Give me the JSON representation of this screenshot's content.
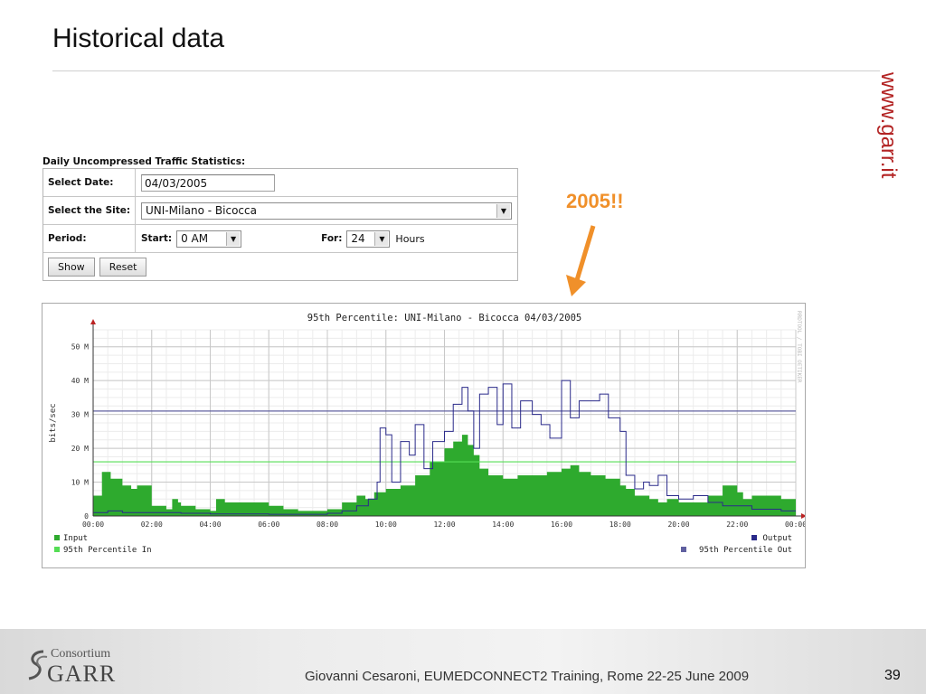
{
  "slide": {
    "title": "Historical data",
    "website": "www.garr.it",
    "annotation": "2005!!",
    "footer_logo_small": "Consortium",
    "footer_logo_big": "GARR",
    "footer_text": "Giovanni Cesaroni, EUMEDCONNECT2 Training, Rome 22-25 June 2009",
    "page_number": "39"
  },
  "form": {
    "title": "Daily Uncompressed Traffic Statistics:",
    "date_label": "Select Date:",
    "date_value": "04/03/2005",
    "site_label": "Select the Site:",
    "site_value": "UNI-Milano - Bicocca",
    "period_label": "Period:",
    "start_label": "Start:",
    "start_value": "0 AM",
    "for_label": "For:",
    "for_value": "24",
    "hours_label": "Hours",
    "show_label": "Show",
    "reset_label": "Reset"
  },
  "colors": {
    "input": "#2eaa2e",
    "output": "#2a2a8a",
    "p95_in": "#55dd55",
    "p95_out": "#6060a0",
    "annotation": "#f0902a",
    "website": "#b32424"
  },
  "chart_data": {
    "type": "area",
    "title": "95th Percentile: UNI-Milano - Bicocca 04/03/2005",
    "ylabel": "bits/sec",
    "xlabel": "",
    "side_text": "RRDTOOL / TOBI OETIKER",
    "ylim": [
      0,
      55
    ],
    "xlim": [
      0,
      24
    ],
    "y_ticks": [
      0,
      10,
      20,
      30,
      40,
      50
    ],
    "y_tick_labels": [
      "0",
      "10 M",
      "20 M",
      "30 M",
      "40 M",
      "50 M"
    ],
    "x_ticks": [
      0,
      2,
      4,
      6,
      8,
      10,
      12,
      14,
      16,
      18,
      20,
      22,
      24
    ],
    "x_tick_labels": [
      "00:00",
      "02:00",
      "04:00",
      "06:00",
      "08:00",
      "10:00",
      "12:00",
      "14:00",
      "16:00",
      "18:00",
      "20:00",
      "22:00",
      "00:00"
    ],
    "grid": true,
    "legend_position": "bottom",
    "legend": [
      "Input",
      "95th Percentile In",
      "Output",
      "95th Percentile Out"
    ],
    "percentile_95_in": 16,
    "percentile_95_out": 31,
    "series": [
      {
        "name": "Input",
        "x": [
          0,
          0.3,
          0.6,
          1.0,
          1.3,
          1.5,
          2.0,
          2.5,
          2.7,
          2.9,
          3.0,
          3.5,
          4.0,
          4.2,
          4.5,
          5.0,
          5.5,
          6.0,
          6.5,
          7.0,
          7.5,
          8.0,
          8.5,
          9.0,
          9.3,
          9.6,
          10.0,
          10.5,
          11.0,
          11.5,
          12.0,
          12.3,
          12.6,
          12.8,
          13.0,
          13.2,
          13.5,
          14.0,
          14.5,
          15.0,
          15.5,
          16.0,
          16.3,
          16.6,
          17.0,
          17.5,
          18.0,
          18.2,
          18.5,
          19.0,
          19.3,
          19.6,
          20.0,
          20.5,
          21.0,
          21.5,
          22.0,
          22.2,
          22.5,
          23.0,
          23.5,
          24.0
        ],
        "values": [
          6,
          13,
          11,
          9,
          8,
          9,
          3,
          2,
          5,
          4,
          3,
          2,
          1.5,
          5,
          4,
          4,
          4,
          3,
          2,
          1.5,
          1.5,
          2,
          4,
          6,
          5,
          7,
          8,
          9,
          12,
          16,
          20,
          22,
          24,
          21,
          18,
          14,
          12,
          11,
          12,
          12,
          13,
          14,
          15,
          13,
          12,
          11,
          9,
          8,
          6,
          5,
          4,
          5,
          4,
          4,
          6,
          9,
          7,
          5,
          6,
          6,
          5,
          5
        ]
      },
      {
        "name": "Output",
        "x": [
          0,
          0.5,
          1.0,
          2.0,
          3.0,
          4.0,
          5.0,
          6.0,
          7.0,
          8.0,
          8.5,
          9.0,
          9.4,
          9.7,
          9.8,
          10.0,
          10.2,
          10.5,
          10.8,
          11.0,
          11.3,
          11.6,
          12.0,
          12.3,
          12.6,
          12.8,
          13.0,
          13.2,
          13.5,
          13.8,
          14.0,
          14.3,
          14.6,
          15.0,
          15.3,
          15.6,
          16.0,
          16.3,
          16.6,
          17.0,
          17.3,
          17.6,
          18.0,
          18.2,
          18.5,
          18.8,
          19.0,
          19.3,
          19.6,
          20.0,
          20.5,
          21.0,
          21.5,
          22.0,
          22.5,
          23.0,
          23.5,
          24.0
        ],
        "values": [
          1,
          1.5,
          1,
          1,
          0.8,
          0.6,
          0.6,
          0.5,
          0.5,
          0.8,
          1.5,
          3,
          5,
          10,
          26,
          24,
          10,
          22,
          18,
          27,
          14,
          22,
          25,
          33,
          38,
          31,
          20,
          36,
          38,
          27,
          39,
          26,
          34,
          30,
          27,
          23,
          40,
          29,
          34,
          34,
          36,
          29,
          25,
          12,
          8,
          10,
          9,
          12,
          6,
          5,
          6,
          4,
          3,
          3,
          2,
          2,
          1.5,
          1.5
        ]
      }
    ]
  }
}
